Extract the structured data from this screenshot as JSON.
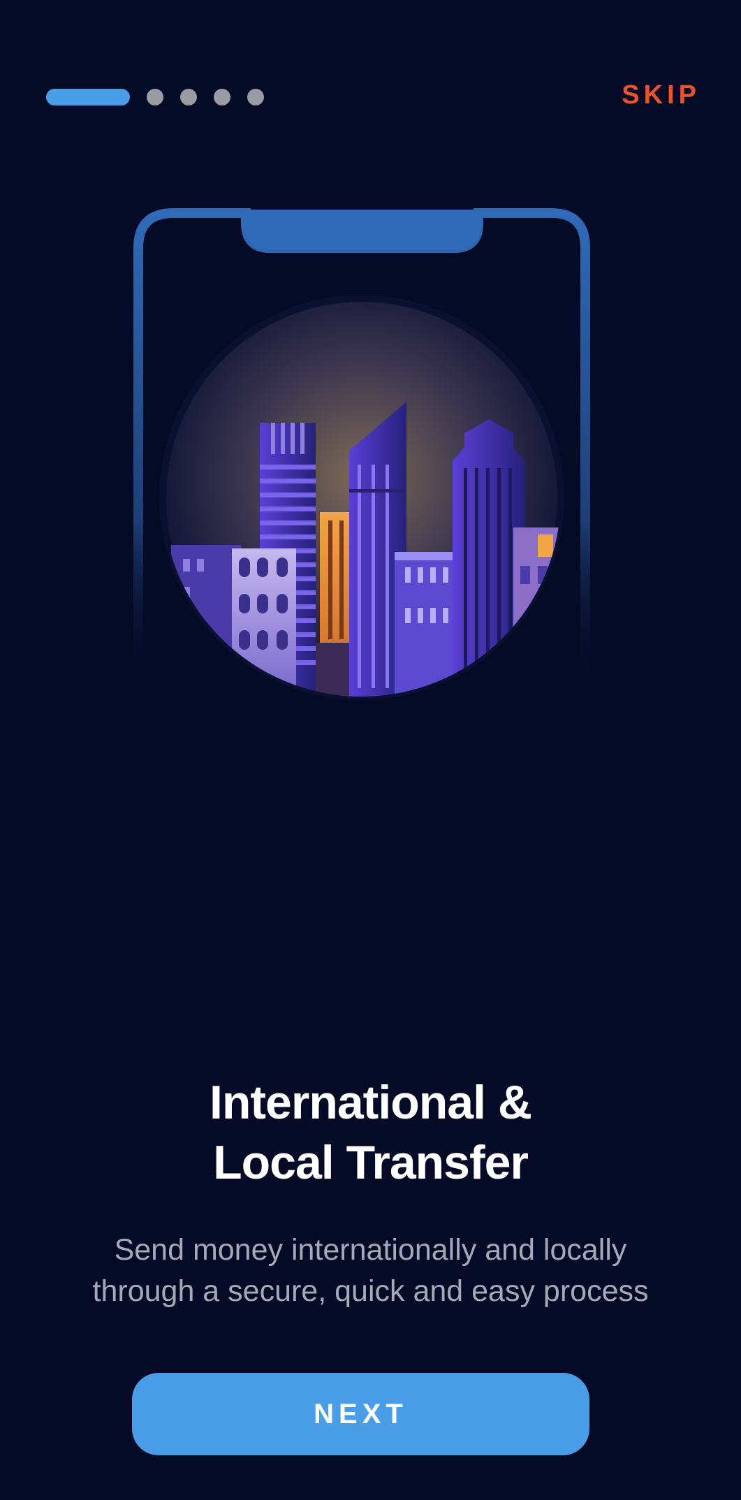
{
  "onboarding": {
    "skip_label": "SKIP",
    "pager": {
      "total_steps": 5,
      "current_step": 1
    },
    "title_line1": "International &",
    "title_line2": "Local Transfer",
    "subtitle_line1": "Send money internationally and locally",
    "subtitle_line2": "through a secure, quick and easy process",
    "next_label": "NEXT",
    "illustration": "phone-with-city-skyline"
  },
  "colors": {
    "background": "#050b27",
    "accent": "#4a9ee8",
    "skip": "#e8552c",
    "inactive_dot": "#9a9ca4",
    "subtitle": "#a7a9b6"
  }
}
